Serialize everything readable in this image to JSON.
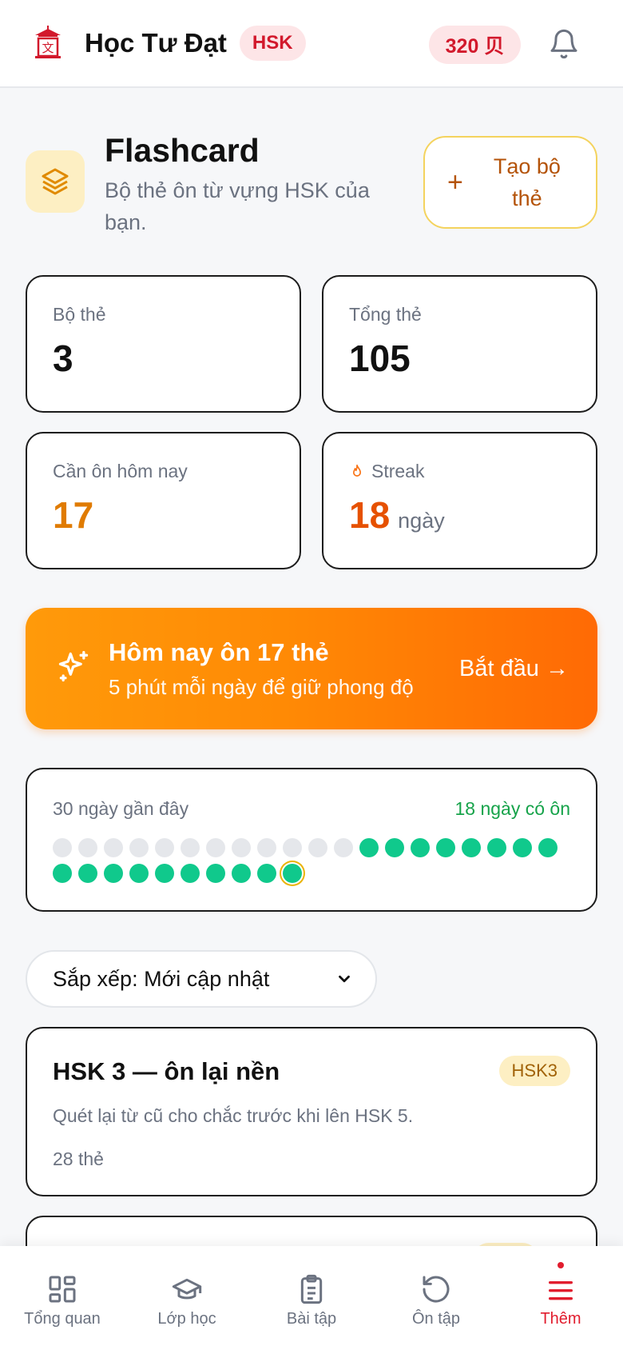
{
  "header": {
    "app_title": "Học Tư Đạt",
    "level_badge": "HSK",
    "points": "320 贝"
  },
  "page": {
    "title": "Flashcard",
    "subtitle": "Bộ thẻ ôn từ vựng HSK của bạn.",
    "create_button": "Tạo bộ thẻ"
  },
  "stats": [
    {
      "label": "Bộ thẻ",
      "value": "3"
    },
    {
      "label": "Tổng thẻ",
      "value": "105"
    },
    {
      "label": "Cần ôn hôm nay",
      "value": "17"
    },
    {
      "label": "Streak",
      "value": "18",
      "unit": "ngày"
    }
  ],
  "banner": {
    "title": "Hôm nay ôn 17 thẻ",
    "subtitle": "5 phút mỗi ngày để giữ phong độ",
    "cta": "Bắt đầu →"
  },
  "activity": {
    "title": "30 ngày gần đây",
    "summary": "18 ngày có ôn",
    "days_inactive": 12,
    "days_active": 18,
    "colors": {
      "active": "#10c98c",
      "inactive": "#e5e7eb",
      "today_ring": "#eab308"
    }
  },
  "sort": {
    "label": "Sắp xếp: Mới cập nhật"
  },
  "decks": [
    {
      "title": "HSK 3 — ôn lại nền",
      "badge": "HSK3",
      "description": "Quét lại từ cũ cho chắc trước khi lên HSK 5.",
      "count": "28 thẻ"
    }
  ],
  "bottom_nav": [
    {
      "label": "Tổng quan",
      "icon": "grid-icon"
    },
    {
      "label": "Lớp học",
      "icon": "graduation-cap-icon"
    },
    {
      "label": "Bài tập",
      "icon": "clipboard-icon"
    },
    {
      "label": "Ôn tập",
      "icon": "refresh-icon"
    },
    {
      "label": "Thêm",
      "icon": "menu-icon",
      "active": true
    }
  ],
  "colors": {
    "brand_red": "#e11d2e",
    "accent_orange": "#ff8a05",
    "success_green": "#16a34a"
  }
}
